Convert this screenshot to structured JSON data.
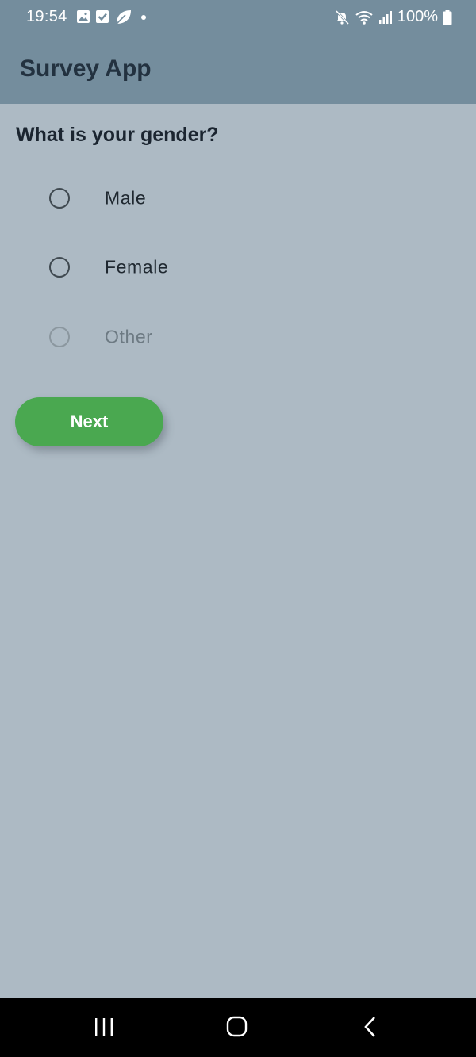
{
  "status_bar": {
    "time": "19:54",
    "battery": "100%",
    "left_icons": [
      "image-icon",
      "check-box-icon",
      "leaf-icon",
      "dot-icon"
    ],
    "right_icons": [
      "mute-icon",
      "wifi-icon",
      "signal-icon",
      "battery-icon"
    ]
  },
  "app_bar": {
    "title": "Survey App"
  },
  "survey": {
    "question": "What is your gender?",
    "options": [
      {
        "label": "Male",
        "selected": false,
        "enabled": true
      },
      {
        "label": "Female",
        "selected": false,
        "enabled": true
      },
      {
        "label": "Other",
        "selected": false,
        "enabled": false
      }
    ],
    "next_label": "Next"
  },
  "colors": {
    "app_bar": "#748d9d",
    "background": "#adbac4",
    "button": "#4aa850"
  },
  "nav_bar": {
    "icons": [
      "recent-apps-icon",
      "home-icon",
      "back-icon"
    ]
  }
}
